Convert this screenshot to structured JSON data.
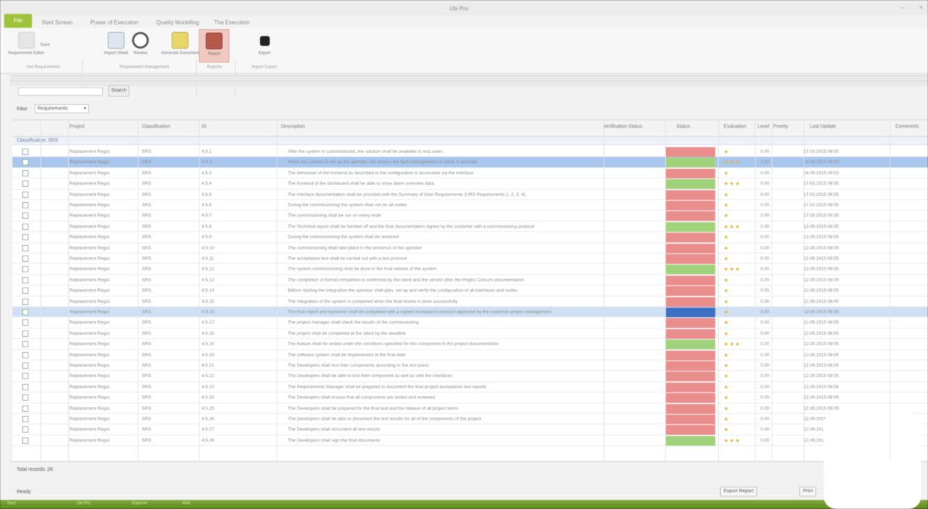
{
  "window": {
    "title": "Ubi Pro"
  },
  "file_tab": "File",
  "tabs": [
    "Start Screen",
    "Power of Execution",
    "Quality Modelling",
    "The Execution"
  ],
  "ribbon": {
    "groups": [
      {
        "label": "Get Requirements",
        "buttons": [
          "Requirement Editor",
          "Save"
        ]
      },
      {
        "label": "Requirement Management",
        "buttons": [
          "Import Sheet",
          "Review",
          "Generate Document"
        ]
      },
      {
        "label": "Reports",
        "buttons": [
          "Report"
        ]
      },
      {
        "label": "Import Export",
        "buttons": [
          "Export"
        ]
      }
    ]
  },
  "search": {
    "button": "Search"
  },
  "filter": {
    "label": "Filter",
    "value": "Requirements"
  },
  "columns": [
    "",
    "",
    "Project",
    "Classification",
    "ID",
    "Description",
    "Verification Status",
    "Status",
    "Evaluation",
    "Level",
    "Priority",
    "Last Update",
    "Comments"
  ],
  "group_header": "Classification: SRS",
  "rows": [
    {
      "id": "4.5.1",
      "text": "After the system is commissioned, the solution shall be available to end users",
      "status": "red",
      "rating": "1",
      "date": "17.03.2015 08:05"
    },
    {
      "id": "4.5.2",
      "text": "When the solution is set up the operator can access the fault management UI within 5 seconds",
      "status": "green",
      "rating": "3",
      "date": "24.09.2015 09:03",
      "sel": "sel"
    },
    {
      "id": "4.5.3",
      "text": "The behaviour of the frontend as described in the configuration is accessible via the interface",
      "status": "red",
      "rating": "1",
      "date": "24.09.2015 09:03"
    },
    {
      "id": "4.5.4",
      "text": "The frontend of the dashboard shall be able to show alarm overview data",
      "status": "green",
      "rating": "3",
      "date": "17.03.2015 08:05"
    },
    {
      "id": "4.5.5",
      "text": "The interface documentation shall be provided with the Summary of User Requirements (URS Requirements 1, 2, 3, 4)",
      "status": "red",
      "rating": "1",
      "date": "17.03.2015 08:05"
    },
    {
      "id": "4.5.6",
      "text": "During the commissioning the system shall run on all nodes",
      "status": "red",
      "rating": "1",
      "date": "17.03.2015 08:05"
    },
    {
      "id": "4.5.7",
      "text": "The commissioning shall be run on every node",
      "status": "red",
      "rating": "1",
      "date": "17.03.2015 08:05"
    },
    {
      "id": "4.5.8",
      "text": "The Technical report shall be handed off and the final documentation signed by the customer with a commissioning protocol",
      "status": "green",
      "rating": "3",
      "date": "12.09.2015 08:05"
    },
    {
      "id": "4.5.9",
      "text": "During the commissioning the system shall be restarted",
      "status": "red",
      "rating": "1",
      "date": "12.09.2015 08:05"
    },
    {
      "id": "4.5.10",
      "text": "The commissioning shall take place in the presence of the operator",
      "status": "red",
      "rating": "1",
      "date": "12.09.2015 08:05"
    },
    {
      "id": "4.5.11",
      "text": "The acceptance test shall be carried out with a test protocol",
      "status": "red",
      "rating": "1",
      "date": "12.09.2015 08:05"
    },
    {
      "id": "4.5.12",
      "text": "The system commissioning shall be done in the final release of the system",
      "status": "green",
      "rating": "3",
      "date": "12.09.2015 08:05"
    },
    {
      "id": "4.5.13",
      "text": "The completion of formal completion is confirmed by the client and the vendor after the Project Closure documentation",
      "status": "red",
      "rating": "1",
      "date": "12.09.2015 08:05"
    },
    {
      "id": "4.5.14",
      "text": "Before starting the integration the operator shall plan, set up and verify the configuration of all interfaces and nodes",
      "status": "red",
      "rating": "1",
      "date": "12.09.2015 08:05"
    },
    {
      "id": "4.5.15",
      "text": "The integration of the system is completed when the final review is done successfully",
      "status": "red",
      "rating": "1",
      "date": "12.09.2015 08:05"
    },
    {
      "id": "4.5.16",
      "text": "The final report and handover shall be completed with a signed acceptance protocol approved by the customer project management",
      "status": "blue",
      "rating": "1",
      "date": "12.09.2015 08:05",
      "sel": "sel2"
    },
    {
      "id": "4.5.17",
      "text": "The project manager shall check the results of the commissioning",
      "status": "red",
      "rating": "1",
      "date": "12.09.2015 08:05"
    },
    {
      "id": "4.5.18",
      "text": "The project shall be completed at the latest by the deadline",
      "status": "red",
      "rating": "1",
      "date": "12.09.2015 08:05"
    },
    {
      "id": "4.5.19",
      "text": "The feature shall be tested under the conditions specified for this component in the project documentation",
      "status": "green",
      "rating": "3",
      "date": "12.09.2015 08:05"
    },
    {
      "id": "4.5.20",
      "text": "The software system shall be implemented at the final date",
      "status": "red",
      "rating": "1",
      "date": "12.09.2015 08:05"
    },
    {
      "id": "4.5.21",
      "text": "The Developers shall test their components according to the test plans",
      "status": "red",
      "rating": "1",
      "date": "12.09.2015 08:05"
    },
    {
      "id": "4.5.22",
      "text": "The Developers shall be able to test their component as well as with the interfaces",
      "status": "red",
      "rating": "1",
      "date": "12.09.2015 08:05"
    },
    {
      "id": "4.5.23",
      "text": "The Requirements Manager shall be prepared to document the final project acceptance test reports",
      "status": "red",
      "rating": "1",
      "date": "12.09.2015 08:05"
    },
    {
      "id": "4.5.24",
      "text": "The Developers shall ensure that all components are tested and reviewed",
      "status": "red",
      "rating": "1",
      "date": "12.09.2015 08:05"
    },
    {
      "id": "4.5.25",
      "text": "The Developers shall be prepared for the final test and the release of all project items",
      "status": "red",
      "rating": "1",
      "date": "12.09.2015 08:05"
    },
    {
      "id": "4.5.26",
      "text": "The Developers shall be able to document the test results for all of the components of the project",
      "status": "red",
      "rating": "1",
      "date": "12.09.2015 08:05"
    },
    {
      "id": "4.5.27",
      "text": "The Developers shall document all test results",
      "status": "red",
      "rating": "1",
      "date": "12.09.2015 08:05"
    },
    {
      "id": "4.5.28",
      "text": "The Developers shall sign the final documents",
      "status": "green",
      "rating": "3",
      "date": "12.09.2015 08:05"
    }
  ],
  "row_common": {
    "project": "Replacement Regul.",
    "classification": "SRS",
    "level": "0.00"
  },
  "footer": {
    "count": "Total records: 28",
    "status": "Ready",
    "buttons": [
      "Export Report",
      "Print"
    ]
  },
  "taskbar": [
    "Start",
    "Ubi Pro",
    "Explorer",
    "Mail"
  ],
  "colors": {
    "accent": "#9fc23b",
    "status_red": "#e98d8d",
    "status_green": "#9fd27b",
    "status_blue": "#3d6fc4",
    "selection": "#a9c7ee"
  }
}
